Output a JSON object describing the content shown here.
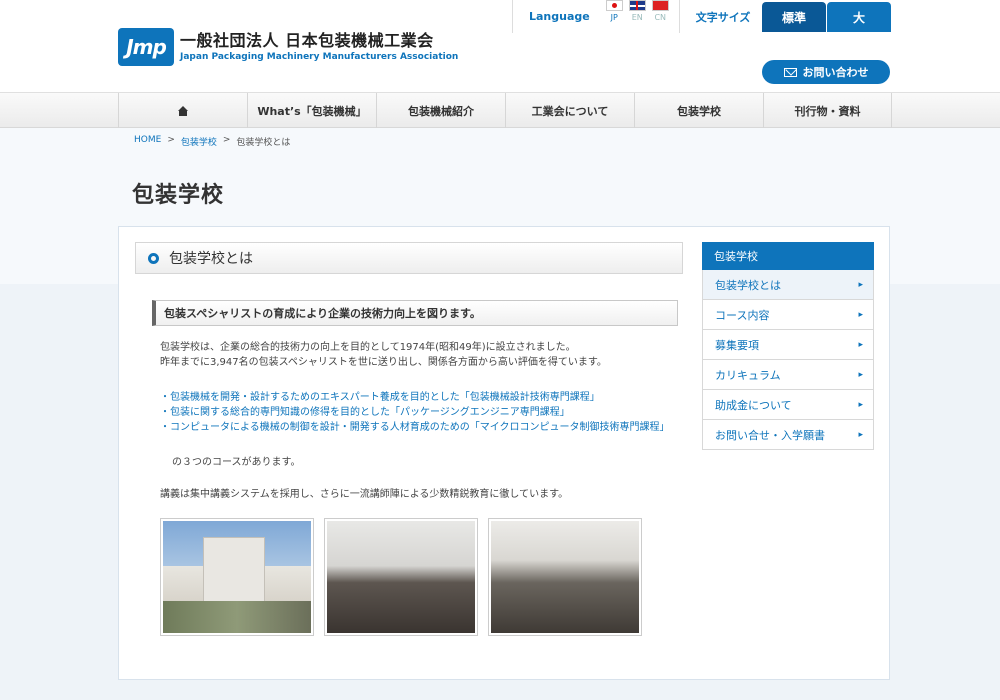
{
  "header": {
    "logo_mark": "Jmp",
    "logo_jp": "一般社団法人 日本包装機械工業会",
    "logo_en": "Japan Packaging Machinery Manufacturers Association",
    "language_label": "Language",
    "flags": [
      {
        "code": "JP",
        "icon": "jp-flag-icon"
      },
      {
        "code": "EN",
        "icon": "uk-flag-icon"
      },
      {
        "code": "CN",
        "icon": "cn-flag-icon"
      }
    ],
    "font_size_label": "文字サイズ",
    "size_standard": "標準",
    "size_large": "大",
    "contact_label": "お問い合わせ"
  },
  "nav": {
    "items": [
      {
        "label": "",
        "icon": "home-icon"
      },
      {
        "label": "What’s「包装機械」"
      },
      {
        "label": "包装機械紹介"
      },
      {
        "label": "工業会について"
      },
      {
        "label": "包装学校"
      },
      {
        "label": "刊行物・資料"
      }
    ]
  },
  "breadcrumb": {
    "home": "HOME",
    "sep": ">",
    "level1": "包装学校",
    "current": "包装学校とは"
  },
  "page": {
    "title": "包装学校",
    "section_title": "包装学校とは",
    "subheading": "包装スペシャリストの育成により企業の技術力向上を図ります。",
    "intro_1": "包装学校は、企業の総合的技術力の向上を目的として1974年(昭和49年)に設立されました。",
    "intro_2": "昨年までに3,947名の包装スペシャリストを世に送り出し、関係各方面から高い評価を得ています。",
    "course_links": [
      "・包装機械を開発・設計するためのエキスパート養成を目的とした「包装機械設計技術専門課程」",
      "・包装に関する総合的専門知識の修得を目的とした「パッケージングエンジニア専門課程」",
      "・コンピュータによる機械の制御を設計・開発する人材育成のための「マイクロコンピュータ制御技術専門課程」"
    ],
    "courses_summary": "の３つのコースがあります。",
    "lecture_note": "講義は集中講義システムを採用し、さらに一流講師陣による少数精鋭教育に徹しています。"
  },
  "sidebar": {
    "title": "包装学校",
    "items": [
      {
        "label": "包装学校とは"
      },
      {
        "label": "コース内容"
      },
      {
        "label": "募集要項"
      },
      {
        "label": "カリキュラム"
      },
      {
        "label": "助成金について"
      },
      {
        "label": "お問い合せ・入学願書"
      }
    ],
    "chevron": "▸"
  },
  "colors": {
    "brand": "#0e74bb",
    "brand_dark": "#0a5896"
  }
}
